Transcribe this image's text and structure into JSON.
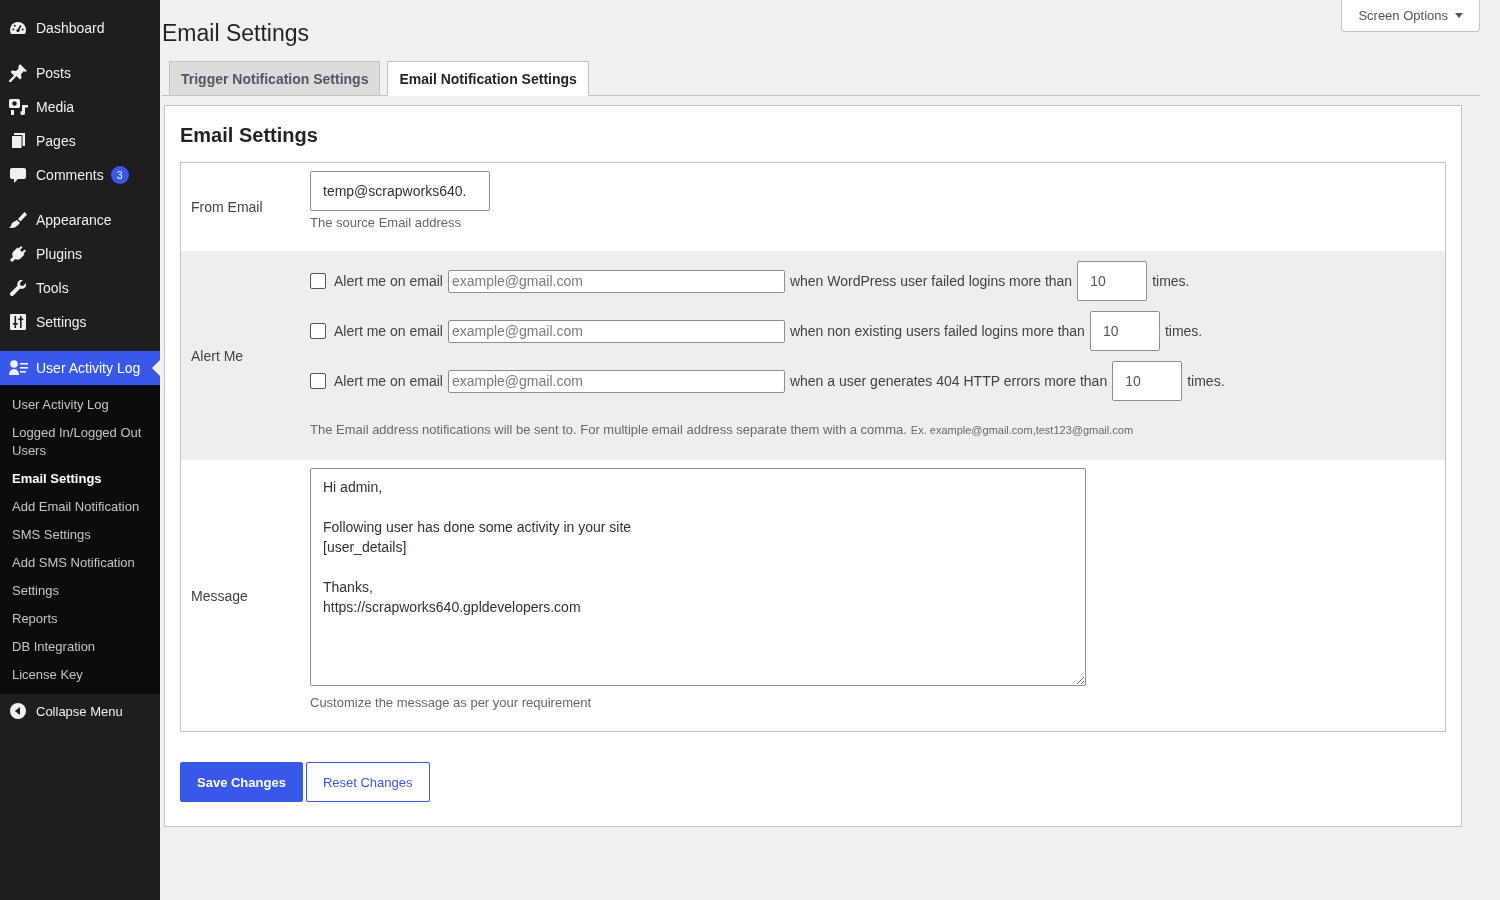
{
  "sidebar": {
    "groups": [
      {
        "items": [
          {
            "label": "Dashboard",
            "selected": false
          }
        ]
      },
      {
        "items": [
          {
            "label": "Posts",
            "selected": false
          },
          {
            "label": "Media",
            "selected": false
          },
          {
            "label": "Pages",
            "selected": false
          },
          {
            "label": "Comments",
            "selected": false,
            "badge": "3"
          }
        ]
      },
      {
        "items": [
          {
            "label": "Appearance",
            "selected": false
          },
          {
            "label": "Plugins",
            "selected": false
          },
          {
            "label": "Tools",
            "selected": false
          },
          {
            "label": "Settings",
            "selected": false
          }
        ]
      },
      {
        "items": [
          {
            "label": "User Activity Log",
            "selected": true,
            "children": [
              {
                "label": "User Activity Log",
                "selected": false
              },
              {
                "label": "Logged In/Logged Out Users",
                "selected": false
              },
              {
                "label": "Email Settings",
                "selected": true
              },
              {
                "label": "Add Email Notification",
                "selected": false
              },
              {
                "label": "SMS Settings",
                "selected": false
              },
              {
                "label": "Add SMS Notification",
                "selected": false
              },
              {
                "label": "Settings",
                "selected": false
              },
              {
                "label": "Reports",
                "selected": false
              },
              {
                "label": "DB Integration",
                "selected": false
              },
              {
                "label": "License Key",
                "selected": false
              }
            ]
          }
        ]
      }
    ],
    "collapse": "Collapse Menu"
  },
  "page_title": "Email Settings",
  "screen_options": {
    "label": "Screen Options"
  },
  "tabs": [
    {
      "label": "Trigger Notification Settings",
      "selected": false
    },
    {
      "label": "Email Notification Settings",
      "selected": true
    }
  ],
  "panel": {
    "heading": "Email Settings",
    "rows": [
      {
        "kind": "text_field",
        "label": "From Email",
        "value": "temp@scrapworks640.",
        "description": "The source Email address"
      },
      {
        "kind": "alerts",
        "label": "Alert Me",
        "alerts": [
          {
            "checked": false,
            "prefix": "Alert me on email",
            "placeholder": "example@gmail.com",
            "condition": "when WordPress user failed logins more than",
            "value": "10",
            "suffix": "times."
          },
          {
            "checked": false,
            "prefix": "Alert me on email",
            "placeholder": "example@gmail.com",
            "condition": "when non existing users failed logins more than",
            "value": "10",
            "suffix": "times."
          },
          {
            "checked": false,
            "prefix": "Alert me on email",
            "placeholder": "example@gmail.com",
            "condition": "when a user generates 404 HTTP errors more than",
            "value": "10",
            "suffix": "times."
          }
        ],
        "description": "The Email address notifications will be sent to. For multiple email address separate them with a comma.",
        "example": "Ex. example@gmail.com,test123@gmail.com"
      },
      {
        "kind": "message",
        "label": "Message",
        "value": "Hi admin,\n\nFollowing user has done some activity in your site\n[user_details]\n\nThanks,\nhttps://scrapworks640.gpldevelopers.com",
        "description": "Customize the message as per your requirement"
      }
    ],
    "buttons": [
      {
        "label": "Save Changes",
        "kind": "primary"
      },
      {
        "label": "Reset Changes",
        "kind": "secondary"
      }
    ]
  }
}
